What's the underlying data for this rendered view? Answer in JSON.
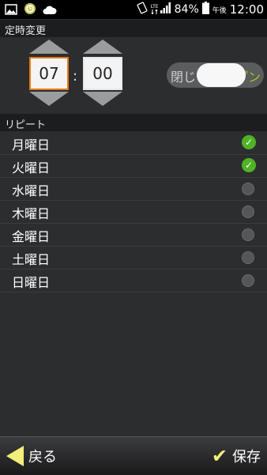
{
  "statusbar": {
    "signal_label": "LTE",
    "battery": "84%",
    "ampm": "午後",
    "time": "12:00"
  },
  "header": {
    "title": "定時変更"
  },
  "time_picker": {
    "hour": "07",
    "minute": "00",
    "separator": ":"
  },
  "toggle": {
    "off_label": "閉じ",
    "on_label": "プン"
  },
  "repeat": {
    "title": "リピート",
    "days": [
      {
        "label": "月曜日",
        "checked": true
      },
      {
        "label": "火曜日",
        "checked": true
      },
      {
        "label": "水曜日",
        "checked": false
      },
      {
        "label": "木曜日",
        "checked": false
      },
      {
        "label": "金曜日",
        "checked": false
      },
      {
        "label": "土曜日",
        "checked": false
      },
      {
        "label": "日曜日",
        "checked": false
      }
    ]
  },
  "bottombar": {
    "back_label": "戻る",
    "save_label": "保存"
  },
  "colors": {
    "accent_orange": "#e87a13",
    "check_green": "#4fb227",
    "toggle_green": "#8ed021",
    "button_yellow": "#f4ee7a"
  }
}
